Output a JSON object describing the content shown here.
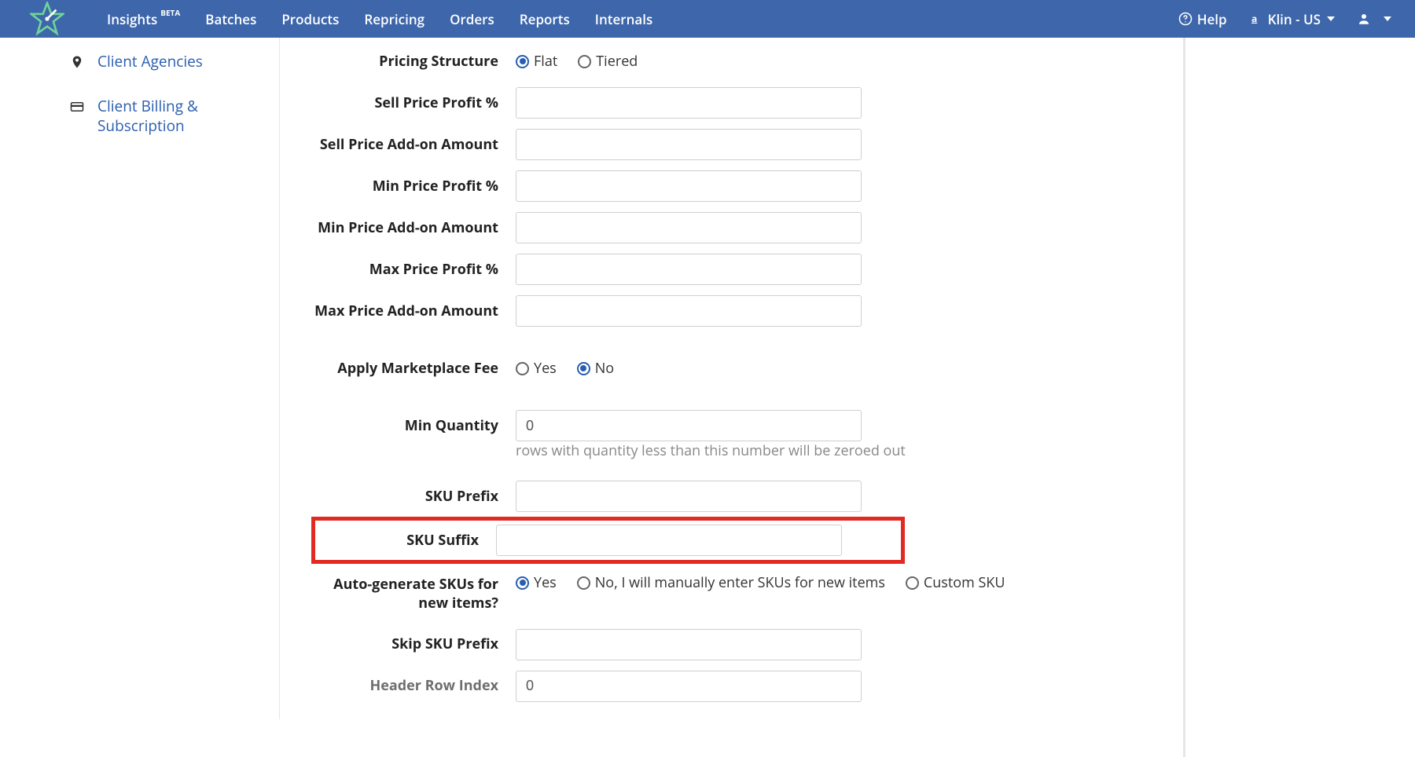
{
  "nav": {
    "items": [
      {
        "label": "Insights",
        "badge": "BETA"
      },
      {
        "label": "Batches"
      },
      {
        "label": "Products"
      },
      {
        "label": "Repricing"
      },
      {
        "label": "Orders"
      },
      {
        "label": "Reports"
      },
      {
        "label": "Internals"
      }
    ],
    "help": "Help",
    "account_label": "Klin - US"
  },
  "sidebar": {
    "items": [
      {
        "icon": "map-marker",
        "label": "Client Agencies"
      },
      {
        "icon": "credit-card",
        "label": "Client Billing & Subscription"
      }
    ]
  },
  "form": {
    "pricing_structure": {
      "label": "Pricing Structure",
      "options": [
        "Flat",
        "Tiered"
      ],
      "selected": "Flat"
    },
    "sell_profit": {
      "label": "Sell Price Profit %",
      "value": ""
    },
    "sell_addon": {
      "label": "Sell Price Add-on Amount",
      "value": ""
    },
    "min_profit": {
      "label": "Min Price Profit %",
      "value": ""
    },
    "min_addon": {
      "label": "Min Price Add-on Amount",
      "value": ""
    },
    "max_profit": {
      "label": "Max Price Profit %",
      "value": ""
    },
    "max_addon": {
      "label": "Max Price Add-on Amount",
      "value": ""
    },
    "apply_fee": {
      "label": "Apply Marketplace Fee",
      "options": [
        "Yes",
        "No"
      ],
      "selected": "No"
    },
    "min_qty": {
      "label": "Min Quantity",
      "value": "0",
      "help": "rows with quantity less than this number will be zeroed out"
    },
    "sku_prefix": {
      "label": "SKU Prefix",
      "value": ""
    },
    "sku_suffix": {
      "label": "SKU Suffix",
      "value": ""
    },
    "auto_sku": {
      "label": "Auto-generate SKUs for new items?",
      "options": [
        "Yes",
        "No, I will manually enter SKUs for new items",
        "Custom SKU"
      ],
      "selected": "Yes"
    },
    "skip_sku_prefix": {
      "label": "Skip SKU Prefix",
      "value": ""
    },
    "header_row": {
      "label": "Header Row Index",
      "value": "0"
    }
  }
}
